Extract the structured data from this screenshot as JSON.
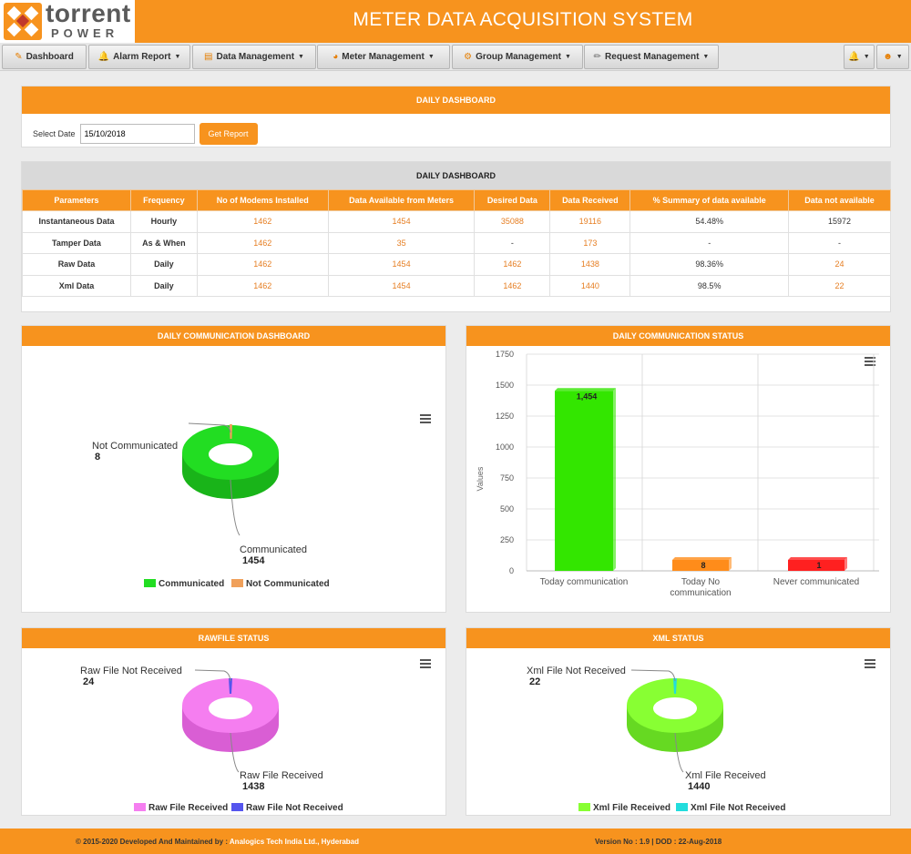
{
  "header": {
    "logo_line1": "torrent",
    "logo_line2": "POWER",
    "title": "METER DATA ACQUISITION SYSTEM"
  },
  "nav": {
    "dashboard": "Dashboard",
    "alarm_report": "Alarm Report",
    "data_management": "Data Management",
    "meter_management": "Meter Management",
    "group_management": "Group Management",
    "request_management": "Request Management"
  },
  "daily_filter": {
    "title": "DAILY DASHBOARD",
    "date_label": "Select Date",
    "date_value": "15/10/2018",
    "button": "Get Report"
  },
  "daily_table": {
    "title": "DAILY DASHBOARD",
    "headers": [
      "Parameters",
      "Frequency",
      "No of Modems Installed",
      "Data Available from Meters",
      "Desired Data",
      "Data Received",
      "% Summary of data available",
      "Data not available"
    ],
    "rows": [
      [
        "Instantaneous Data",
        "Hourly",
        "1462",
        "1454",
        "35088",
        "19116",
        "54.48%",
        "15972"
      ],
      [
        "Tamper Data",
        "As & When",
        "1462",
        "35",
        "-",
        "173",
        "-",
        "-"
      ],
      [
        "Raw Data",
        "Daily",
        "1462",
        "1454",
        "1462",
        "1438",
        "98.36%",
        "24"
      ],
      [
        "Xml Data",
        "Daily",
        "1462",
        "1454",
        "1462",
        "1440",
        "98.5%",
        "22"
      ]
    ]
  },
  "charts": {
    "comm": {
      "title": "DAILY COMMUNICATION DASHBOARD",
      "label_small": "Not Communicated",
      "value_small": "8",
      "label_big": "Communicated",
      "value_big": "1454",
      "legend_a": "Communicated",
      "legend_b": "Not Communicated"
    },
    "status": {
      "title": "DAILY COMMUNICATION STATUS",
      "ylabel": "Values",
      "ticks": [
        "0",
        "250",
        "500",
        "750",
        "1000",
        "1250",
        "1500",
        "1750"
      ],
      "cat1": "Today communication",
      "cat2_line1": "Today No",
      "cat2_line2": "communication",
      "cat3": "Never communicated",
      "val1": "1,454",
      "val2": "8",
      "val3": "1"
    },
    "raw": {
      "title": "RAWFILE STATUS",
      "label_small": "Raw File Not Received",
      "value_small": "24",
      "label_big": "Raw File Received",
      "value_big": "1438",
      "legend_a": "Raw File Received",
      "legend_b": "Raw File Not Received"
    },
    "xml": {
      "title": "XML STATUS",
      "label_small": "Xml File Not Received",
      "value_small": "22",
      "label_big": "Xml File Received",
      "value_big": "1440",
      "legend_a": "Xml File Received",
      "legend_b": "Xml File Not Received"
    }
  },
  "chart_data": [
    {
      "type": "pie",
      "title": "DAILY COMMUNICATION DASHBOARD",
      "categories": [
        "Communicated",
        "Not Communicated"
      ],
      "values": [
        1454,
        8
      ],
      "colors": [
        "#22dd22",
        "#f0a05a"
      ],
      "legend": "bottom"
    },
    {
      "type": "bar",
      "title": "DAILY COMMUNICATION STATUS",
      "categories": [
        "Today communication",
        "Today No communication",
        "Never communicated"
      ],
      "values": [
        1454,
        8,
        1
      ],
      "colors": [
        "#33e600",
        "#ff8c1a",
        "#ff2020"
      ],
      "ylabel": "Values",
      "ylim": [
        0,
        1750
      ],
      "grid": true
    },
    {
      "type": "pie",
      "title": "RAWFILE STATUS",
      "categories": [
        "Raw File Received",
        "Raw File Not Received"
      ],
      "values": [
        1438,
        24
      ],
      "colors": [
        "#f57ef0",
        "#5555ee"
      ],
      "legend": "bottom"
    },
    {
      "type": "pie",
      "title": "XML STATUS",
      "categories": [
        "Xml File Received",
        "Xml File Not Received"
      ],
      "values": [
        1440,
        22
      ],
      "colors": [
        "#88ff33",
        "#22dddd"
      ],
      "legend": "bottom"
    }
  ],
  "footer": {
    "copyright": "© 2015-2020 Developed And Maintained by : ",
    "company": "Analogics Tech India Ltd., Hyderabad",
    "version": "Version No : 1.9 | DOD : 22-Aug-2018"
  },
  "colors": {
    "brand": "#f7931e",
    "link": "#e67e22"
  }
}
